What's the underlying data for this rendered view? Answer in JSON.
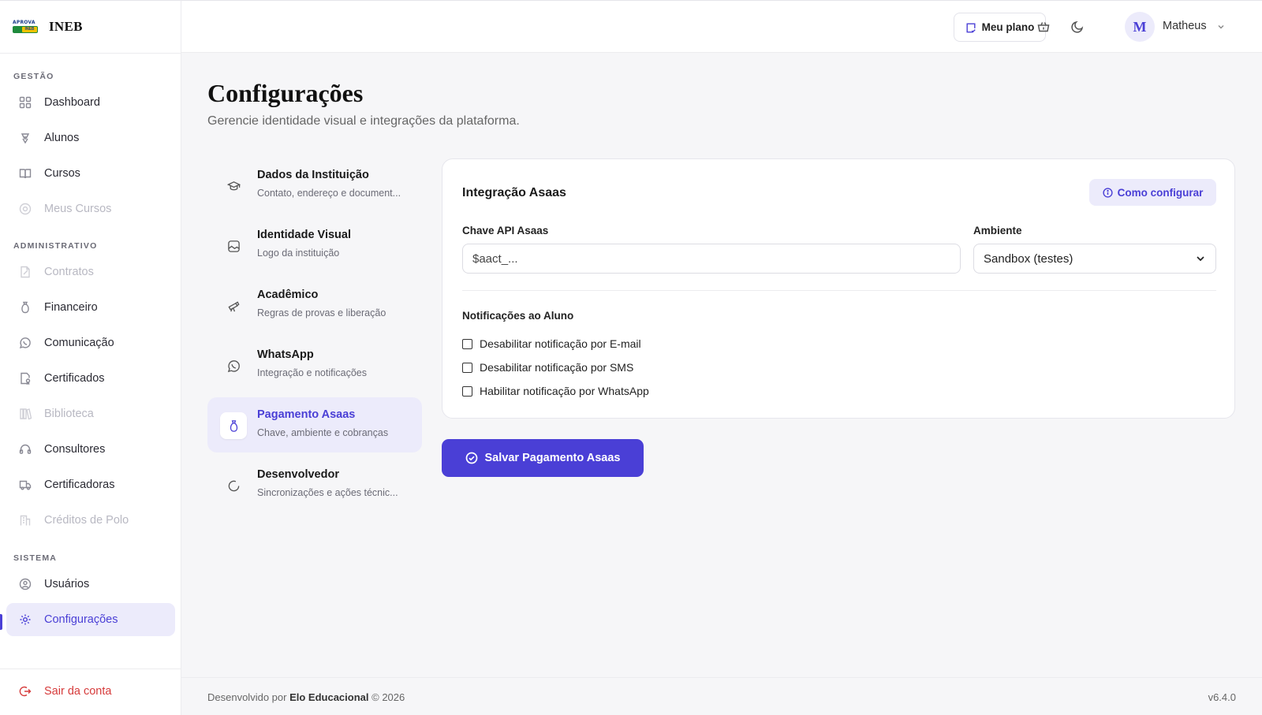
{
  "brand": {
    "logo_top": "APROVA",
    "logo_bottom": "INEB",
    "name": "INEB"
  },
  "sidebar": {
    "sections": [
      "GESTÃO",
      "ADMINISTRATIVO",
      "SISTEMA"
    ],
    "items": [
      {
        "label": "Dashboard",
        "icon": "grid-icon"
      },
      {
        "label": "Alunos",
        "icon": "students-icon"
      },
      {
        "label": "Cursos",
        "icon": "book-icon"
      },
      {
        "label": "Meus Cursos",
        "icon": "target-icon",
        "disabled": true
      },
      {
        "label": "Contratos",
        "icon": "contract-icon",
        "disabled": true
      },
      {
        "label": "Financeiro",
        "icon": "money-bag-icon"
      },
      {
        "label": "Comunicação",
        "icon": "whatsapp-icon"
      },
      {
        "label": "Certificados",
        "icon": "certificate-icon"
      },
      {
        "label": "Biblioteca",
        "icon": "library-icon",
        "disabled": true
      },
      {
        "label": "Consultores",
        "icon": "headset-icon"
      },
      {
        "label": "Certificadoras",
        "icon": "truck-icon"
      },
      {
        "label": "Créditos de Polo",
        "icon": "building-icon",
        "disabled": true
      },
      {
        "label": "Usuários",
        "icon": "user-shield-icon"
      },
      {
        "label": "Configurações",
        "icon": "gear-icon",
        "active": true
      }
    ],
    "logout": "Sair da conta"
  },
  "topbar": {
    "plan_label": "Meu plano",
    "user_initial": "M",
    "user_name": "Matheus"
  },
  "page": {
    "title": "Configurações",
    "subtitle": "Gerencie identidade visual e integrações da plataforma."
  },
  "settings_nav": [
    {
      "title": "Dados da Instituição",
      "desc": "Contato, endereço e document..."
    },
    {
      "title": "Identidade Visual",
      "desc": "Logo da instituição"
    },
    {
      "title": "Acadêmico",
      "desc": "Regras de provas e liberação"
    },
    {
      "title": "WhatsApp",
      "desc": "Integração e notificações"
    },
    {
      "title": "Pagamento Asaas",
      "desc": "Chave, ambiente e cobranças",
      "active": true
    },
    {
      "title": "Desenvolvedor",
      "desc": "Sincronizações e ações técnic..."
    }
  ],
  "card": {
    "title": "Integração Asaas",
    "howto_label": "Como configurar",
    "api_label": "Chave API Asaas",
    "api_placeholder": "$aact_...",
    "env_label": "Ambiente",
    "env_value": "Sandbox (testes)",
    "notif_title": "Notificações ao Aluno",
    "checks": [
      {
        "label": "Desabilitar notificação por E-mail",
        "checked": false
      },
      {
        "label": "Desabilitar notificação por SMS",
        "checked": false
      },
      {
        "label": "Habilitar notificação por WhatsApp",
        "checked": false
      }
    ]
  },
  "save_label": "Salvar Pagamento Asaas",
  "footer": {
    "prefix": "Desenvolvido por",
    "company": "Elo Educacional",
    "suffix": "© 2026",
    "version": "v6.4.0"
  },
  "colors": {
    "accent": "#4a3fd6",
    "accent_soft": "#ecebfb",
    "danger": "#d63b3b"
  }
}
